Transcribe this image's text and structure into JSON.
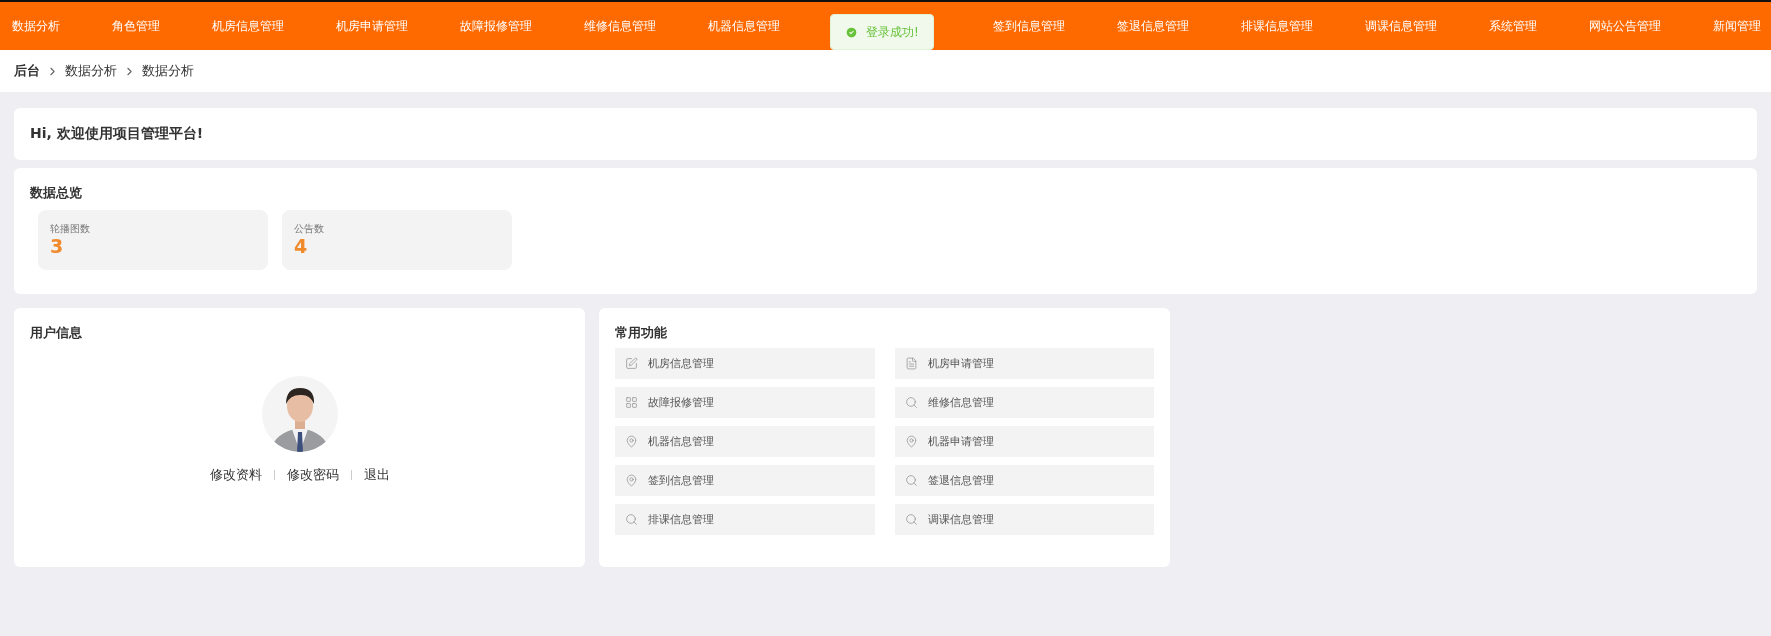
{
  "nav": {
    "items": [
      {
        "label": "数据分析"
      },
      {
        "label": "角色管理"
      },
      {
        "label": "机房信息管理"
      },
      {
        "label": "机房申请管理"
      },
      {
        "label": "故障报修管理"
      },
      {
        "label": "维修信息管理"
      },
      {
        "label": "机器信息管理"
      },
      {
        "label": "签到信息管理"
      },
      {
        "label": "签退信息管理"
      },
      {
        "label": "排课信息管理"
      },
      {
        "label": "调课信息管理"
      },
      {
        "label": "系统管理"
      },
      {
        "label": "网站公告管理"
      },
      {
        "label": "新闻管理"
      }
    ]
  },
  "toast": {
    "message": "登录成功!"
  },
  "breadcrumb": [
    "后台",
    "数据分析",
    "数据分析"
  ],
  "welcome": {
    "text": "Hi, 欢迎使用项目管理平台!"
  },
  "overview": {
    "title": "数据总览",
    "stats": [
      {
        "label": "轮播图数",
        "value": "3"
      },
      {
        "label": "公告数",
        "value": "4"
      }
    ]
  },
  "user_info": {
    "title": "用户信息",
    "links": [
      "修改资料",
      "修改密码",
      "退出"
    ]
  },
  "quick_functions": {
    "title": "常用功能",
    "items": [
      {
        "label": "机房信息管理",
        "kind": "edit"
      },
      {
        "label": "机房申请管理",
        "kind": "document"
      },
      {
        "label": "故障报修管理",
        "kind": "grid"
      },
      {
        "label": "维修信息管理",
        "kind": "search"
      },
      {
        "label": "机器信息管理",
        "kind": "pin"
      },
      {
        "label": "机器申请管理",
        "kind": "pin"
      },
      {
        "label": "签到信息管理",
        "kind": "pin"
      },
      {
        "label": "签退信息管理",
        "kind": "search"
      },
      {
        "label": "排课信息管理",
        "kind": "search"
      },
      {
        "label": "调课信息管理",
        "kind": "search"
      }
    ]
  }
}
